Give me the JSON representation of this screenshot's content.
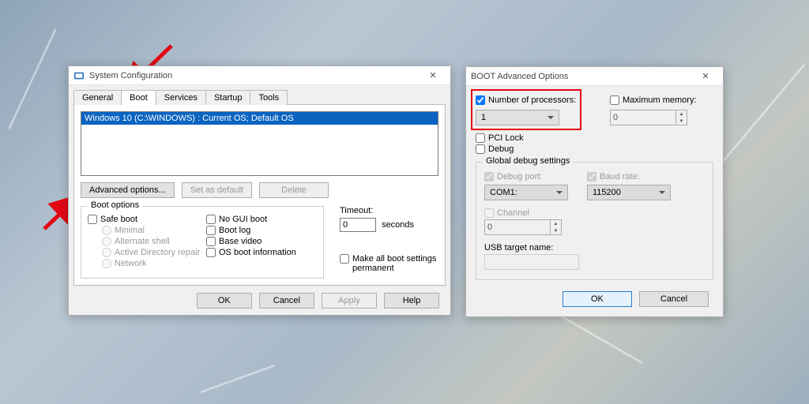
{
  "sysconfig": {
    "title": "System Configuration",
    "tabs": [
      "General",
      "Boot",
      "Services",
      "Startup",
      "Tools"
    ],
    "active_tab": 1,
    "os_entry": "Windows 10 (C:\\WINDOWS) : Current OS; Default OS",
    "buttons": {
      "adv": "Advanced options...",
      "setdef": "Set as default",
      "delete": "Delete"
    },
    "boot_options": {
      "legend": "Boot options",
      "safe_boot": "Safe boot",
      "minimal": "Minimal",
      "altshell": "Alternate shell",
      "adrepair": "Active Directory repair",
      "network": "Network",
      "nogui": "No GUI boot",
      "bootlog": "Boot log",
      "basevideo": "Base video",
      "osinfo": "OS boot information"
    },
    "timeout": {
      "label": "Timeout:",
      "value": "0",
      "unit": "seconds"
    },
    "permanent": "Make all boot settings permanent",
    "dialog_buttons": {
      "ok": "OK",
      "cancel": "Cancel",
      "apply": "Apply",
      "help": "Help"
    }
  },
  "bao": {
    "title": "BOOT Advanced Options",
    "numproc": {
      "label": "Number of processors:",
      "value": "1"
    },
    "maxmem": {
      "label": "Maximum memory:",
      "value": "0"
    },
    "pcilock": "PCI Lock",
    "debug": "Debug",
    "global": {
      "legend": "Global debug settings",
      "debugport": {
        "label": "Debug port:",
        "value": "COM1:"
      },
      "baud": {
        "label": "Baud rate:",
        "value": "115200"
      },
      "channel": {
        "label": "Channel",
        "value": "0"
      },
      "usb": {
        "label": "USB target name:",
        "value": ""
      }
    },
    "ok": "OK",
    "cancel": "Cancel"
  },
  "colors": {
    "highlight": "#e30613",
    "select": "#0a64c2"
  }
}
